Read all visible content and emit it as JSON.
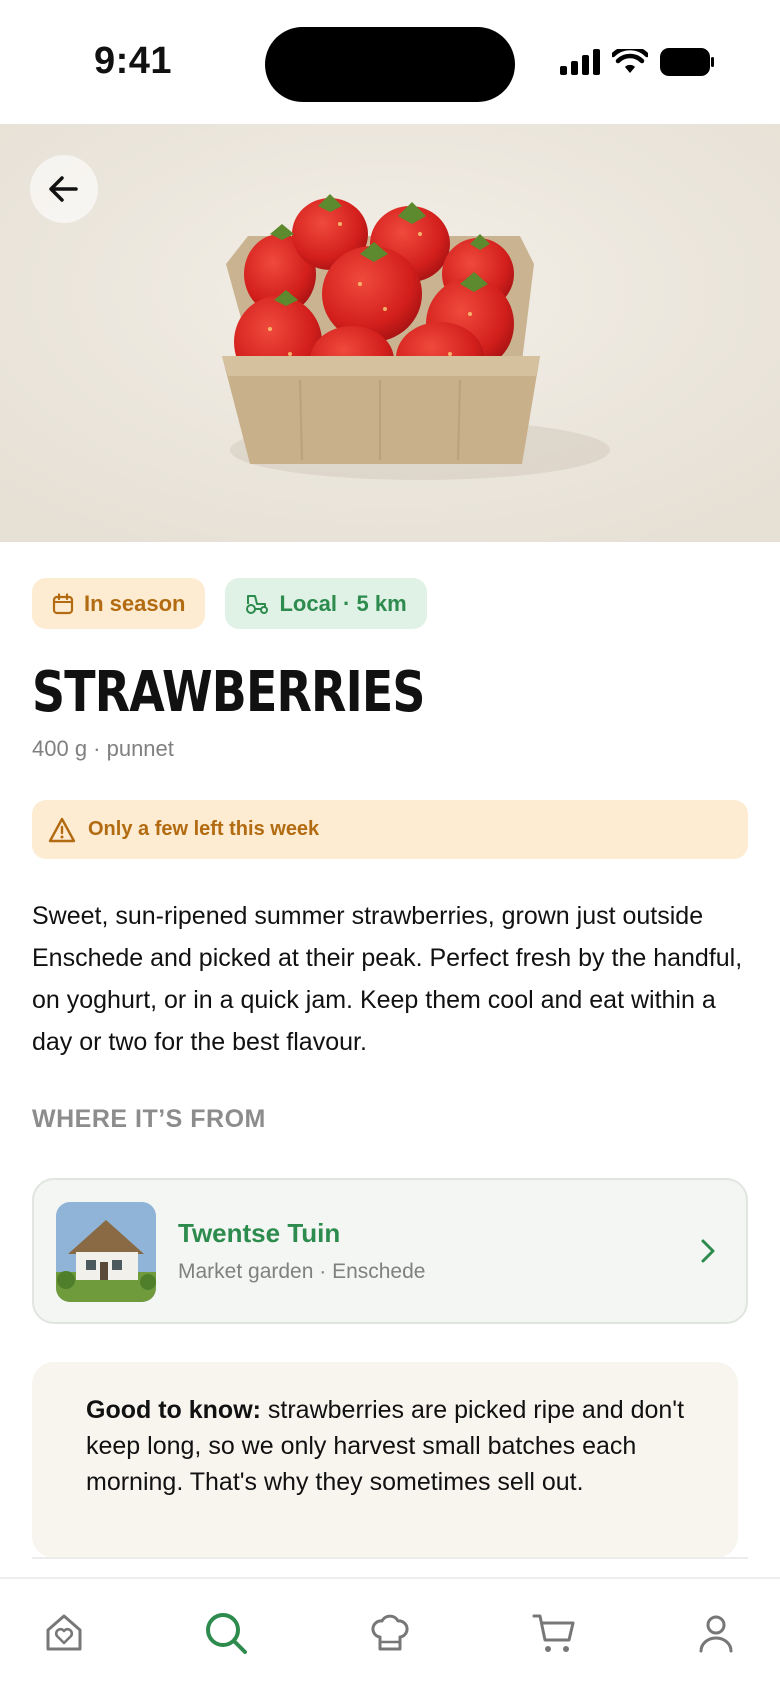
{
  "status_bar": {
    "time": "9:41"
  },
  "hero": {
    "image_icon": "strawberry-punnet-photo"
  },
  "chips": {
    "season": {
      "label": "In season",
      "icon": "calendar-icon"
    },
    "local": {
      "label": "Local · 5 km",
      "icon": "tractor-icon"
    }
  },
  "product": {
    "title": "STRAWBERRIES",
    "subtitle": "400 g · punnet",
    "stock_warning": "Only a few left this week",
    "description": "Sweet, sun-ripened summer strawberries, grown just outside Enschede and picked at their peak. Perfect fresh by the handful, on yoghurt, or in a quick jam. Keep them cool and eat within a day or two for the best flavour."
  },
  "origin": {
    "heading": "WHERE IT’S FROM",
    "farm_name": "Twentse Tuin",
    "farm_meta": "Market garden · Enschede"
  },
  "good_to_know": {
    "label": "Good to know:",
    "text": " strawberries are picked ripe and don't keep long, so we only harvest small batches each morning. That's why they sometimes sell out."
  },
  "tab_bar": {
    "active": "search",
    "items": [
      "home",
      "search",
      "recipes",
      "cart",
      "profile"
    ]
  },
  "colors": {
    "accent_green": "#2e8b4e",
    "warning_orange": "#b26b11",
    "warning_bg": "#fdebd2",
    "local_bg": "#e0f2e6"
  }
}
